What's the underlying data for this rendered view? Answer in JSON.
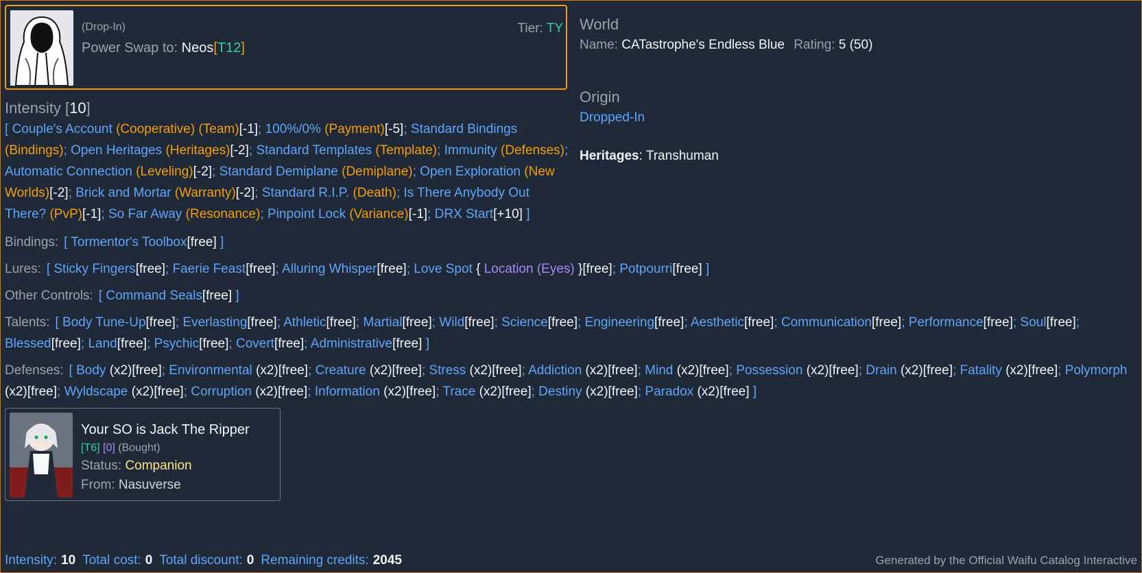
{
  "character": {
    "origin_tag": "(Drop-In)",
    "tier_label": "Tier:",
    "tier_value": "TY",
    "swap_label": "Power Swap to:",
    "swap_name": "Neos",
    "swap_tier": "T12"
  },
  "world": {
    "title": "World",
    "name_label": "Name:",
    "name_value": "CATastrophe's Endless Blue",
    "rating_label": "Rating:",
    "rating_value": "5",
    "rating_extra": "(50)"
  },
  "intensity": {
    "title": "Intensity",
    "value": "10",
    "open": "[",
    "close": "]",
    "items": [
      {
        "name": "Couple's Account",
        "category": "Cooperative",
        "suffix_cat": "Team",
        "cost": "-1"
      },
      {
        "name": "100%/0%",
        "category": "Payment",
        "cost": "-5"
      },
      {
        "name": "Standard Bindings",
        "category": "Bindings",
        "cost": ""
      },
      {
        "name": "Open Heritages",
        "category": "Heritages",
        "cost": "-2"
      },
      {
        "name": "Standard Templates",
        "category": "Template",
        "cost": ""
      },
      {
        "name": "Immunity",
        "category": "Defenses",
        "cost": ""
      },
      {
        "name": "Automatic Connection",
        "category": "Leveling",
        "cost": "-2"
      },
      {
        "name": "Standard Demiplane",
        "category": "Demiplane",
        "cost": ""
      },
      {
        "name": "Open Exploration",
        "category": "New Worlds",
        "cost": "-2"
      },
      {
        "name": "Brick and Mortar",
        "category": "Warranty",
        "cost": "-2"
      },
      {
        "name": "Standard R.I.P.",
        "category": "Death",
        "cost": ""
      },
      {
        "name": "Is There Anybody Out There?",
        "category": "PvP",
        "cost": "-1"
      },
      {
        "name": "So Far Away",
        "category": "Resonance",
        "cost": ""
      },
      {
        "name": "Pinpoint Lock",
        "category": "Variance",
        "cost": "-1"
      },
      {
        "name": "DRX Start",
        "category": "",
        "cost": "+10"
      }
    ]
  },
  "origin": {
    "title": "Origin",
    "value": "Dropped-In",
    "heritages_label": "Heritages",
    "heritages_value": "Transhuman"
  },
  "lists": {
    "bindings": {
      "label": "Bindings:",
      "items": [
        {
          "name": "Tormentor's Toolbox",
          "cost": "free"
        }
      ]
    },
    "lures": {
      "label": "Lures:",
      "items": [
        {
          "name": "Sticky Fingers",
          "cost": "free"
        },
        {
          "name": "Faerie Feast",
          "cost": "free"
        },
        {
          "name": "Alluring Whisper",
          "cost": "free"
        },
        {
          "name": "Love Spot",
          "cost": "free",
          "sub": "Location (Eyes)"
        },
        {
          "name": "Potpourri",
          "cost": "free"
        }
      ]
    },
    "other_controls": {
      "label": "Other Controls:",
      "items": [
        {
          "name": "Command Seals",
          "cost": "free"
        }
      ]
    },
    "talents": {
      "label": "Talents:",
      "items": [
        {
          "name": "Body Tune-Up",
          "cost": "free"
        },
        {
          "name": "Everlasting",
          "cost": "free"
        },
        {
          "name": "Athletic",
          "cost": "free"
        },
        {
          "name": "Martial",
          "cost": "free"
        },
        {
          "name": "Wild",
          "cost": "free"
        },
        {
          "name": "Science",
          "cost": "free"
        },
        {
          "name": "Engineering",
          "cost": "free"
        },
        {
          "name": "Aesthetic",
          "cost": "free"
        },
        {
          "name": "Communication",
          "cost": "free"
        },
        {
          "name": "Performance",
          "cost": "free"
        },
        {
          "name": "Soul",
          "cost": "free"
        },
        {
          "name": "Blessed",
          "cost": "free"
        },
        {
          "name": "Land",
          "cost": "free"
        },
        {
          "name": "Psychic",
          "cost": "free"
        },
        {
          "name": "Covert",
          "cost": "free"
        },
        {
          "name": "Administrative",
          "cost": "free"
        }
      ]
    },
    "defenses": {
      "label": "Defenses:",
      "items": [
        {
          "name": "Body",
          "mult": "(x2)",
          "cost": "free"
        },
        {
          "name": "Environmental",
          "mult": "(x2)",
          "cost": "free"
        },
        {
          "name": "Creature",
          "mult": "(x2)",
          "cost": "free"
        },
        {
          "name": "Stress",
          "mult": "(x2)",
          "cost": "free"
        },
        {
          "name": "Addiction",
          "mult": "(x2)",
          "cost": "free"
        },
        {
          "name": "Mind",
          "mult": "(x2)",
          "cost": "free"
        },
        {
          "name": "Possession",
          "mult": "(x2)",
          "cost": "free"
        },
        {
          "name": "Drain",
          "mult": "(x2)",
          "cost": "free"
        },
        {
          "name": "Fatality",
          "mult": "(x2)",
          "cost": "free"
        },
        {
          "name": "Polymorph",
          "mult": "(x2)",
          "cost": "free"
        },
        {
          "name": "Wyldscape",
          "mult": "(x2)",
          "cost": "free"
        },
        {
          "name": "Corruption",
          "mult": "(x2)",
          "cost": "free"
        },
        {
          "name": "Information",
          "mult": "(x2)",
          "cost": "free"
        },
        {
          "name": "Trace",
          "mult": "(x2)",
          "cost": "free"
        },
        {
          "name": "Destiny",
          "mult": "(x2)",
          "cost": "free"
        },
        {
          "name": "Paradox",
          "mult": "(x2)",
          "cost": "free"
        }
      ]
    }
  },
  "waifu": {
    "name": "Your SO is Jack The Ripper",
    "tier": "[T6]",
    "count": "[0]",
    "acquired": "(Bought)",
    "status_label": "Status:",
    "status_value": "Companion",
    "from_label": "From:",
    "from_value": "Nasuverse"
  },
  "footer": {
    "intensity_label": "Intensity:",
    "intensity_value": "10",
    "total_cost_label": "Total cost:",
    "total_cost_value": "0",
    "total_discount_label": "Total discount:",
    "total_discount_value": "0",
    "remaining_label": "Remaining credits:",
    "remaining_value": "2045",
    "generated_by": "Generated by the Official Waifu Catalog Interactive"
  },
  "colors": {
    "background": "#1f2937",
    "accent_orange": "#f59e0b",
    "link_blue": "#60a5fa",
    "tier_green": "#34d399",
    "sub_purple": "#a78bfa"
  }
}
